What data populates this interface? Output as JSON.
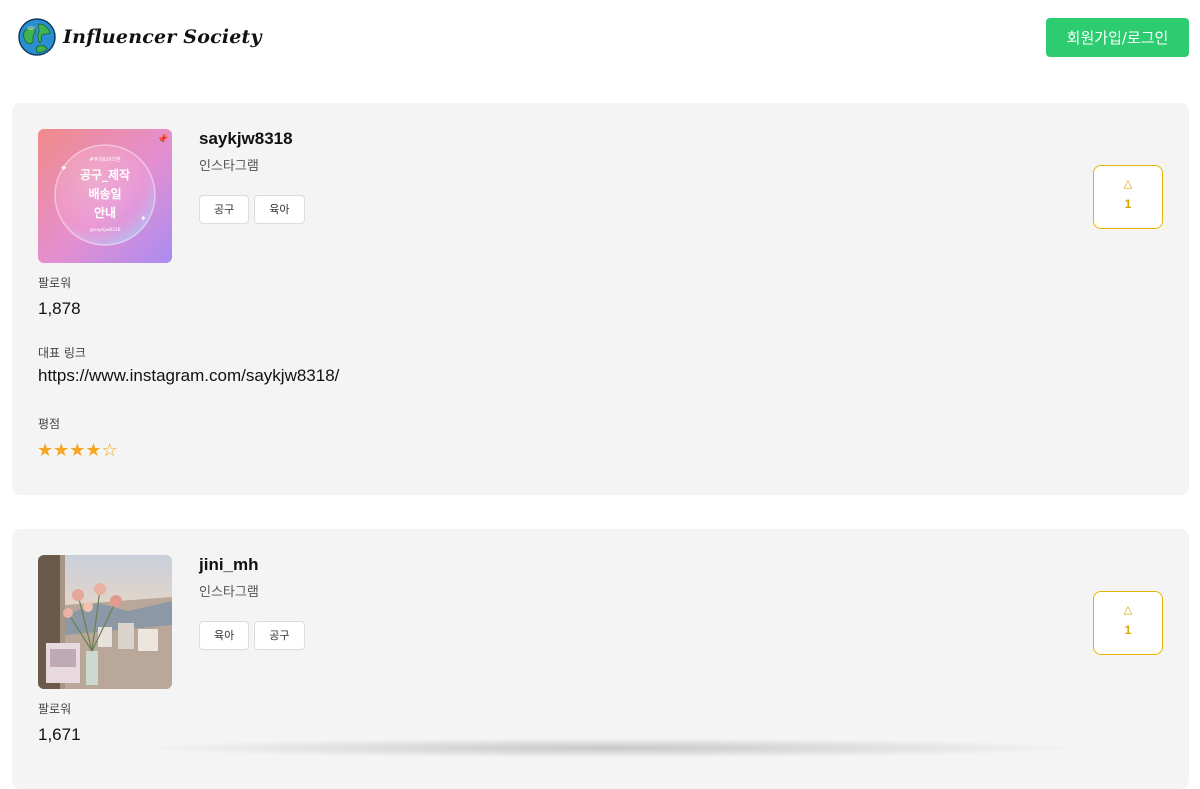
{
  "app": {
    "logo_text": "Influencer Society",
    "login_label": "회원가입/로그인"
  },
  "colors": {
    "accent": "#2ecc71",
    "vote": "#d9a400",
    "star": "#f5a623",
    "card_bg": "#f4f4f4"
  },
  "labels": {
    "followers": "팔로워",
    "link": "대표 링크",
    "rating": "평점"
  },
  "influencers": [
    {
      "username": "saykjw8318",
      "platform": "인스타그램",
      "tags": [
        "공구",
        "육아"
      ],
      "votes": "1",
      "followers": "1,878",
      "link": "https://www.instagram.com/saykjw8318/",
      "rating": 4,
      "rating_max": 5,
      "thumb": {
        "small_text": "#주의&미리맨",
        "line1": "공구_제작",
        "line2": "배송일",
        "line3": "안내",
        "handle": "@saykjw8318"
      }
    },
    {
      "username": "jini_mh",
      "platform": "인스타그램",
      "tags": [
        "육아",
        "공구"
      ],
      "votes": "1",
      "followers": "1,671"
    }
  ]
}
